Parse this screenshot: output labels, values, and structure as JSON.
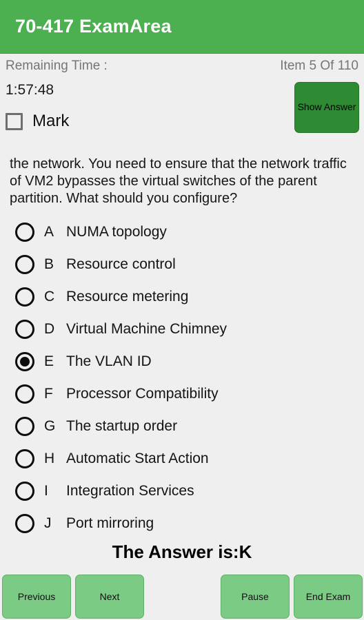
{
  "appbar": {
    "title": "70-417 ExamArea"
  },
  "meta": {
    "remaining_time_label": "Remaining Time :",
    "item_counter": "Item 5 Of 110"
  },
  "timer": {
    "value": "1:57:48"
  },
  "mark": {
    "label": "Mark",
    "checked": false
  },
  "show_answer": {
    "label": "Show Answer"
  },
  "question": {
    "text": "the network. You need to ensure that the network traffic of VM2 bypasses the virtual switches of the parent partition. What should you configure?"
  },
  "options": [
    {
      "letter": "A",
      "text": "NUMA topology",
      "selected": false
    },
    {
      "letter": "B",
      "text": "Resource control",
      "selected": false
    },
    {
      "letter": "C",
      "text": "Resource metering",
      "selected": false
    },
    {
      "letter": "D",
      "text": "Virtual Machine Chimney",
      "selected": false
    },
    {
      "letter": "E",
      "text": "The VLAN ID",
      "selected": true
    },
    {
      "letter": "F",
      "text": "Processor Compatibility",
      "selected": false
    },
    {
      "letter": "G",
      "text": "The startup order",
      "selected": false
    },
    {
      "letter": "H",
      "text": "Automatic Start Action",
      "selected": false
    },
    {
      "letter": "I",
      "text": "Integration Services",
      "selected": false
    },
    {
      "letter": "J",
      "text": "Port mirroring",
      "selected": false
    }
  ],
  "answer": {
    "text": "The Answer is:K"
  },
  "buttons": {
    "previous": "Previous",
    "next": "Next",
    "pause": "Pause",
    "end_exam": "End Exam"
  },
  "colors": {
    "appbar_green": "#4caf50",
    "show_answer_green": "#2e8b33",
    "nav_button_green": "#7ccb85",
    "page_background": "#efefef",
    "meta_text": "#757575"
  }
}
